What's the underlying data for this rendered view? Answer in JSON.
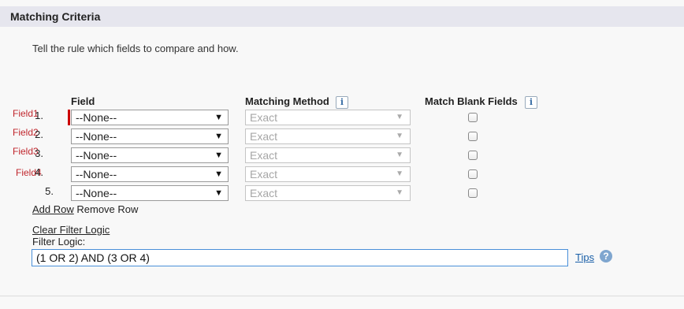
{
  "section": {
    "title": "Matching Criteria",
    "description": "Tell the rule which fields to compare and how."
  },
  "columns": {
    "field": "Field",
    "matching_method": "Matching Method",
    "match_blank": "Match Blank Fields",
    "info_glyph": "i"
  },
  "rows": [
    {
      "annotation": "Field1",
      "number": "1.",
      "field": "--None--",
      "method": "Exact",
      "match_blank": false
    },
    {
      "annotation": "Field2",
      "number": "2.",
      "field": "--None--",
      "method": "Exact",
      "match_blank": false
    },
    {
      "annotation": "Field3",
      "number": "3.",
      "field": "--None--",
      "method": "Exact",
      "match_blank": false
    },
    {
      "annotation": "Field4",
      "number": "4.",
      "field": "--None--",
      "method": "Exact",
      "match_blank": false
    },
    {
      "annotation": "",
      "number": "5.",
      "field": "--None--",
      "method": "Exact",
      "match_blank": false
    }
  ],
  "row_actions": {
    "add_row": "Add Row",
    "remove_row": "Remove Row"
  },
  "filter": {
    "clear_link": "Clear Filter Logic",
    "label": "Filter Logic:",
    "value": "(1 OR 2) AND (3 OR 4)",
    "tips_link": "Tips",
    "help_glyph": "?"
  },
  "glyphs": {
    "field_arrow": "▼",
    "method_arrow": "▼"
  },
  "icons": [
    "info-icon",
    "help-icon",
    "dropdown-arrow-icon"
  ],
  "colors": {
    "header_bg": "#e6e6ee",
    "annotation_red": "#c0262d",
    "required_red": "#cc0000",
    "link_blue": "#1a5fa8",
    "focus_border": "#4a90d9"
  }
}
